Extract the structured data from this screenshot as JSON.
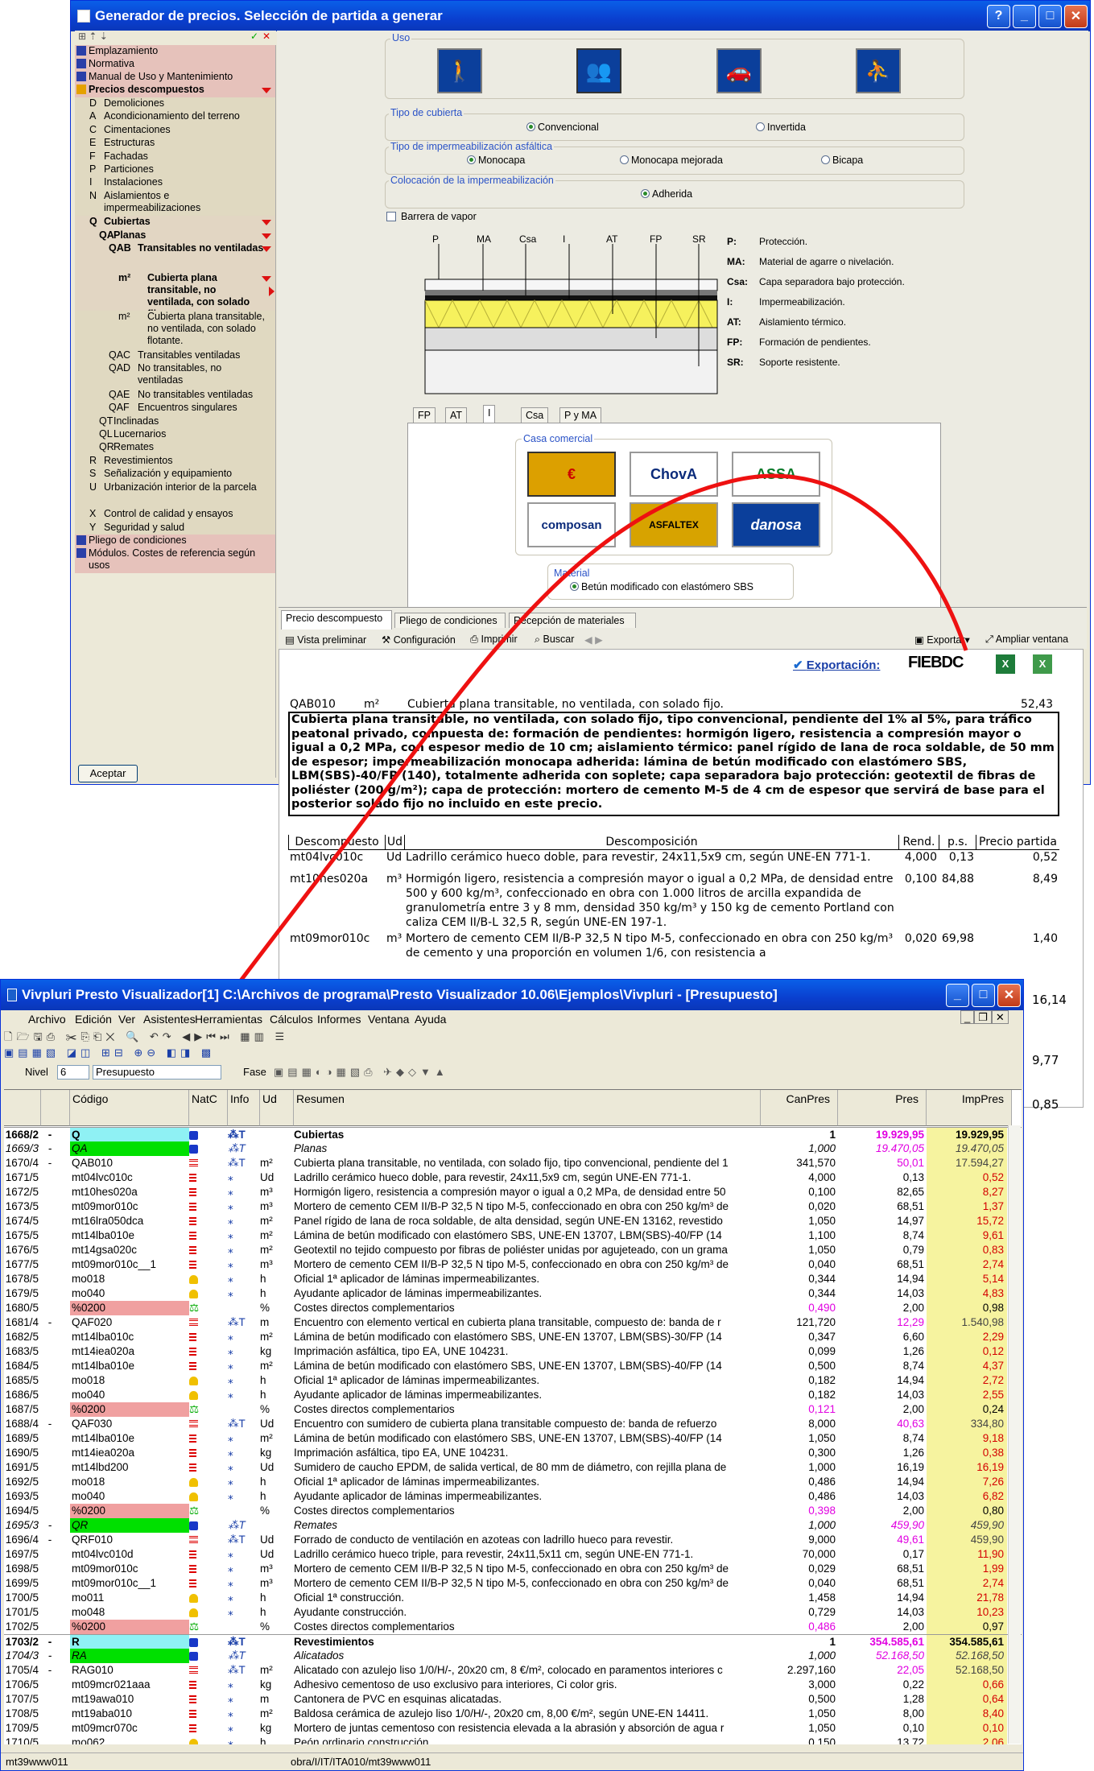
{
  "gen": {
    "title": "Generador de precios. Selección de partida a generar",
    "tree": [
      {
        "label": "Emplazamiento",
        "t": "hdr0"
      },
      {
        "label": "Normativa",
        "t": "hdr0"
      },
      {
        "label": "Manual de Uso y Mantenimiento",
        "t": "hdr0"
      },
      {
        "label": "Precios descompuestos",
        "t": "hdr"
      },
      {
        "code": "D",
        "label": "Demoliciones"
      },
      {
        "code": "A",
        "label": "Acondicionamiento del terreno"
      },
      {
        "code": "C",
        "label": "Cimentaciones"
      },
      {
        "code": "E",
        "label": "Estructuras"
      },
      {
        "code": "F",
        "label": "Fachadas"
      },
      {
        "code": "P",
        "label": "Particiones"
      },
      {
        "code": "I",
        "label": "Instalaciones"
      },
      {
        "code": "N",
        "label": "Aislamientos e impermeabilizaciones"
      },
      {
        "code": "Q",
        "label": "Cubiertas"
      },
      {
        "code": "QA",
        "label": "Planas"
      },
      {
        "code": "QAB",
        "label": "Transitables no ventiladas"
      },
      {
        "code": "m²",
        "label": "Cubierta plana transitable, no ventilada, con solado fijo."
      },
      {
        "code": "m²",
        "label": "Cubierta plana transitable, no ventilada, con solado flotante."
      },
      {
        "code": "QAC",
        "label": "Transitables ventiladas"
      },
      {
        "code": "QAD",
        "label": "No transitables, no ventiladas"
      },
      {
        "code": "QAE",
        "label": "No transitables ventiladas"
      },
      {
        "code": "QAF",
        "label": "Encuentros singulares"
      },
      {
        "code": "QT",
        "label": "Inclinadas"
      },
      {
        "code": "QL",
        "label": "Lucernarios"
      },
      {
        "code": "QR",
        "label": "Remates"
      },
      {
        "code": "R",
        "label": "Revestimientos"
      },
      {
        "code": "S",
        "label": "Señalización y equipamiento"
      },
      {
        "code": "U",
        "label": "Urbanización interior de la parcela"
      },
      {
        "code": "X",
        "label": "Control de calidad y ensayos"
      },
      {
        "code": "Y",
        "label": "Seguridad y salud"
      },
      {
        "label": "Pliego de condiciones",
        "t": "hdr0"
      },
      {
        "label": "Módulos. Costes de referencia según usos",
        "t": "hdr0"
      }
    ],
    "accept": "Aceptar",
    "uso": "Uso",
    "tipo_cubierta": "Tipo de cubierta",
    "convencional": "Convencional",
    "invertida": "Invertida",
    "tipo_imper": "Tipo de impermeabilización asfáltica",
    "monocapa": "Monocapa",
    "monocapa_mejorada": "Monocapa mejorada",
    "bicapa": "Bicapa",
    "colocacion": "Colocación de la impermeabilización",
    "adherida": "Adherida",
    "barrera": "Barrera de vapor",
    "diagram_labels": [
      "P",
      "MA",
      "Csa",
      "I",
      "AT",
      "FP",
      "SR"
    ],
    "legend": [
      {
        "k": "P:",
        "v": "Protección."
      },
      {
        "k": "MA:",
        "v": "Material de agarre o nivelación."
      },
      {
        "k": "Csa:",
        "v": "Capa separadora bajo protección."
      },
      {
        "k": "I:",
        "v": "Impermeabilización."
      },
      {
        "k": "AT:",
        "v": "Aislamiento térmico."
      },
      {
        "k": "FP:",
        "v": "Formación de pendientes."
      },
      {
        "k": "SR:",
        "v": "Soporte resistente."
      }
    ],
    "layer_tabs": [
      "FP",
      "AT",
      "I",
      "Csa",
      "P y MA"
    ],
    "casa": "Casa comercial",
    "brands": [
      "€",
      "ChovA",
      "ASSA",
      "composan",
      "ASFALTEX",
      "danosa"
    ],
    "material": "Material",
    "material_val": "Betún modificado con elastómero SBS",
    "doc_tabs": [
      "Precio descompuesto",
      "Pliego de condiciones",
      "Recepción de materiales"
    ],
    "doc_tools": [
      "Vista preliminar",
      "Configuración",
      "Imprimir",
      "Buscar"
    ],
    "exportar": "Exportar",
    "ampliar": "Ampliar ventana",
    "exportacion": "Exportación:",
    "fiebdc": "FIEBDC",
    "code": "QAB010",
    "unit": "m²",
    "short": "Cubierta plana transitable, no ventilada, con solado fijo.",
    "price": "52,43",
    "long": "Cubierta plana transitable, no ventilada, con solado fijo, tipo convencional, pendiente del 1% al 5%, para tráfico peatonal privado, compuesta de: formación de pendientes: hormigón ligero, resistencia a compresión mayor o igual a 0,2 MPa, con espesor medio de 10 cm; aislamiento térmico: panel rígido de lana de roca soldable, de 50 mm de espesor; impermeabilización monocapa adherida: lámina de betún modificado con elastómero SBS, LBM(SBS)-40/FP (140), totalmente adherida con soplete; capa separadora bajo protección: geotextil de fibras de poliéster (200 g/m²); capa de protección: mortero de cemento M-5 de 4 cm de espesor que servirá de base para el posterior solado fijo no incluido en este precio.",
    "dh": [
      "Descompuesto",
      "Ud",
      "Descomposición",
      "Rend.",
      "p.s.",
      "Precio partida"
    ],
    "drows": [
      [
        "mt04lvc010c",
        "Ud",
        "Ladrillo cerámico hueco doble, para revestir, 24x11,5x9 cm, según UNE-EN 771-1.",
        "4,000",
        "0,13",
        "0,52"
      ],
      [
        "mt10hes020a",
        "m³",
        "Hormigón ligero, resistencia a compresión mayor o igual a 0,2 MPa, de densidad entre 500 y 600 kg/m³, confeccionado en obra con 1.000 litros de arcilla expandida de granulometría entre 3 y 8 mm, densidad 350 kg/m³ y 150 kg de cemento Portland con caliza CEM II/B-L 32,5 R, según UNE-EN 197-1.",
        "0,100",
        "84,88",
        "8,49"
      ],
      [
        "mt09mor010c",
        "m³",
        "Mortero de cemento CEM II/B-P 32,5 N tipo M-5, confeccionado en obra con 250 kg/m³ de cemento y una proporción en volumen 1/6, con resistencia a",
        "0,020",
        "69,98",
        "1,40"
      ]
    ],
    "side_nums": [
      "16,14",
      "9,77",
      "0,85"
    ]
  },
  "viv": {
    "title": "Vivpluri Presto Visualizador[1] C:\\Archivos de programa\\Presto Visualizador 10.06\\Ejemplos\\Vivpluri - [Presupuesto]",
    "menu": [
      "Archivo",
      "Edición",
      "Ver",
      "Asistentes",
      "Herramientas",
      "Cálculos",
      "Informes",
      "Ventana",
      "Ayuda"
    ],
    "nivel": "Nivel",
    "nivel_val": "6",
    "tabla": "Presupuesto",
    "fase": "Fase",
    "cols": [
      "Código",
      "NatC",
      "Info",
      "Ud",
      "Resumen",
      "CanPres",
      "Pres",
      "ImpPres"
    ],
    "rows": [
      [
        "1668/2",
        "-",
        "Q",
        "c",
        "Cubiertas",
        "",
        "1",
        "19.929,95",
        "19.929,95",
        "b"
      ],
      [
        "1669/3",
        "-",
        "QA",
        "c",
        "Planas",
        "",
        "1,000",
        "19.470,05",
        "19.470,05",
        "i"
      ],
      [
        "1670/4",
        "-",
        "QAB010",
        "p",
        "Cubierta plana transitable, no ventilada, con solado fijo, tipo convencional, pendiente del 1",
        "m²",
        "341,570",
        "50,01",
        "17.594,27",
        "p"
      ],
      [
        "1671/5",
        "",
        "mt04lvc010c",
        "m",
        "Ladrillo cerámico hueco doble, para revestir, 24x11,5x9 cm, según UNE-EN 771-1.",
        "Ud",
        "4,000",
        "0,13",
        "0,52",
        ""
      ],
      [
        "1672/5",
        "",
        "mt10hes020a",
        "m",
        "Hormigón ligero, resistencia a compresión mayor o igual a 0,2 MPa, de densidad entre 50",
        "m³",
        "0,100",
        "82,65",
        "8,27",
        ""
      ],
      [
        "1673/5",
        "",
        "mt09mor010c",
        "m",
        "Mortero de cemento CEM II/B-P 32,5 N tipo M-5, confeccionado en obra con 250 kg/m³ de",
        "m³",
        "0,020",
        "68,51",
        "1,37",
        ""
      ],
      [
        "1674/5",
        "",
        "mt16lra050dca",
        "m",
        "Panel rígido de lana de roca soldable, de alta densidad, según UNE-EN 13162, revestido",
        "m²",
        "1,050",
        "14,97",
        "15,72",
        ""
      ],
      [
        "1675/5",
        "",
        "mt14lba010e",
        "m",
        "Lámina de betún modificado con elastómero SBS, UNE-EN 13707, LBM(SBS)-40/FP (14",
        "m²",
        "1,100",
        "8,74",
        "9,61",
        ""
      ],
      [
        "1676/5",
        "",
        "mt14gsa020c",
        "m",
        "Geotextil no tejido compuesto por fibras de poliéster unidas por agujeteado, con un grama",
        "m²",
        "1,050",
        "0,79",
        "0,83",
        ""
      ],
      [
        "1677/5",
        "",
        "mt09mor010c__1",
        "m",
        "Mortero de cemento CEM II/B-P 32,5 N tipo M-5, confeccionado en obra con 250 kg/m³ de",
        "m³",
        "0,040",
        "68,51",
        "2,74",
        ""
      ],
      [
        "1678/5",
        "",
        "mo018",
        "o",
        "Oficial 1ª aplicador de láminas impermeabilizantes.",
        "h",
        "0,344",
        "14,94",
        "5,14",
        ""
      ],
      [
        "1679/5",
        "",
        "mo040",
        "o",
        "Ayudante aplicador de láminas impermeabilizantes.",
        "h",
        "0,344",
        "14,03",
        "4,83",
        ""
      ],
      [
        "1680/5",
        "",
        "%0200",
        "x",
        "Costes directos complementarios",
        "%",
        "0,490",
        "2,00",
        "0,98",
        "r"
      ],
      [
        "1681/4",
        "-",
        "QAF020",
        "p",
        "Encuentro con elemento vertical en cubierta plana transitable, compuesto de: banda de r",
        "m",
        "121,720",
        "12,29",
        "1.540,98",
        "p"
      ],
      [
        "1682/5",
        "",
        "mt14lba010c",
        "m",
        "Lámina de betún modificado con elastómero SBS, UNE-EN 13707, LBM(SBS)-30/FP (14",
        "m²",
        "0,347",
        "6,60",
        "2,29",
        ""
      ],
      [
        "1683/5",
        "",
        "mt14iea020a",
        "m",
        "Imprimación asfáltica, tipo EA, UNE 104231.",
        "kg",
        "0,099",
        "1,26",
        "0,12",
        ""
      ],
      [
        "1684/5",
        "",
        "mt14lba010e",
        "m",
        "Lámina de betún modificado con elastómero SBS, UNE-EN 13707, LBM(SBS)-40/FP (14",
        "m²",
        "0,500",
        "8,74",
        "4,37",
        ""
      ],
      [
        "1685/5",
        "",
        "mo018",
        "o",
        "Oficial 1ª aplicador de láminas impermeabilizantes.",
        "h",
        "0,182",
        "14,94",
        "2,72",
        ""
      ],
      [
        "1686/5",
        "",
        "mo040",
        "o",
        "Ayudante aplicador de láminas impermeabilizantes.",
        "h",
        "0,182",
        "14,03",
        "2,55",
        ""
      ],
      [
        "1687/5",
        "",
        "%0200",
        "x",
        "Costes directos complementarios",
        "%",
        "0,121",
        "2,00",
        "0,24",
        "r"
      ],
      [
        "1688/4",
        "-",
        "QAF030",
        "p",
        "Encuentro con sumidero de cubierta plana transitable compuesto de: banda de refuerzo",
        "Ud",
        "8,000",
        "40,63",
        "334,80",
        "p"
      ],
      [
        "1689/5",
        "",
        "mt14lba010e",
        "m",
        "Lámina de betún modificado con elastómero SBS, UNE-EN 13707, LBM(SBS)-40/FP (14",
        "m²",
        "1,050",
        "8,74",
        "9,18",
        ""
      ],
      [
        "1690/5",
        "",
        "mt14iea020a",
        "m",
        "Imprimación asfáltica, tipo EA, UNE 104231.",
        "kg",
        "0,300",
        "1,26",
        "0,38",
        ""
      ],
      [
        "1691/5",
        "",
        "mt14lbd200",
        "m",
        "Sumidero de caucho EPDM, de salida vertical, de 80 mm de diámetro, con rejilla plana de",
        "Ud",
        "1,000",
        "16,19",
        "16,19",
        ""
      ],
      [
        "1692/5",
        "",
        "mo018",
        "o",
        "Oficial 1ª aplicador de láminas impermeabilizantes.",
        "h",
        "0,486",
        "14,94",
        "7,26",
        ""
      ],
      [
        "1693/5",
        "",
        "mo040",
        "o",
        "Ayudante aplicador de láminas impermeabilizantes.",
        "h",
        "0,486",
        "14,03",
        "6,82",
        ""
      ],
      [
        "1694/5",
        "",
        "%0200",
        "x",
        "Costes directos complementarios",
        "%",
        "0,398",
        "2,00",
        "0,80",
        "r"
      ],
      [
        "1695/3",
        "-",
        "QR",
        "c",
        "Remates",
        "",
        "1,000",
        "459,90",
        "459,90",
        "i"
      ],
      [
        "1696/4",
        "-",
        "QRF010",
        "p",
        "Forrado de conducto de ventilación en azoteas con ladrillo hueco para revestir.",
        "Ud",
        "9,000",
        "49,61",
        "459,90",
        "p"
      ],
      [
        "1697/5",
        "",
        "mt04lvc010d",
        "m",
        "Ladrillo cerámico hueco triple, para revestir, 24x11,5x11 cm, según UNE-EN 771-1.",
        "Ud",
        "70,000",
        "0,17",
        "11,90",
        ""
      ],
      [
        "1698/5",
        "",
        "mt09mor010c",
        "m",
        "Mortero de cemento CEM II/B-P 32,5 N tipo M-5, confeccionado en obra con 250 kg/m³ de",
        "m³",
        "0,029",
        "68,51",
        "1,99",
        ""
      ],
      [
        "1699/5",
        "",
        "mt09mor010c__1",
        "m",
        "Mortero de cemento CEM II/B-P 32,5 N tipo M-5, confeccionado en obra con 250 kg/m³ de",
        "m³",
        "0,040",
        "68,51",
        "2,74",
        ""
      ],
      [
        "1700/5",
        "",
        "mo011",
        "o",
        "Oficial 1ª construcción.",
        "h",
        "1,458",
        "14,94",
        "21,78",
        ""
      ],
      [
        "1701/5",
        "",
        "mo048",
        "o",
        "Ayudante construcción.",
        "h",
        "0,729",
        "14,03",
        "10,23",
        ""
      ],
      [
        "1702/5",
        "",
        "%0200",
        "x",
        "Costes directos complementarios",
        "%",
        "0,486",
        "2,00",
        "0,97",
        "r"
      ],
      [
        "1703/2",
        "-",
        "R",
        "c",
        "Revestimientos",
        "",
        "1",
        "354.585,61",
        "354.585,61",
        "b"
      ],
      [
        "1704/3",
        "-",
        "RA",
        "c",
        "Alicatados",
        "",
        "1,000",
        "52.168,50",
        "52.168,50",
        "i"
      ],
      [
        "1705/4",
        "-",
        "RAG010",
        "p",
        "Alicatado con azulejo liso 1/0/H/-, 20x20 cm, 8 €/m², colocado en paramentos interiores c",
        "m²",
        "2.297,160",
        "22,05",
        "52.168,50",
        "p"
      ],
      [
        "1706/5",
        "",
        "mt09mcr021aaa",
        "m",
        "Adhesivo cementoso de uso exclusivo para interiores, Ci color gris.",
        "kg",
        "3,000",
        "0,22",
        "0,66",
        ""
      ],
      [
        "1707/5",
        "",
        "mt19awa010",
        "m",
        "Cantonera de PVC en esquinas alicatadas.",
        "m",
        "0,500",
        "1,28",
        "0,64",
        ""
      ],
      [
        "1708/5",
        "",
        "mt19aba010",
        "m",
        "Baldosa cerámica de azulejo liso 1/0/H/-, 20x20 cm, 8,00 €/m², según UNE-EN 14411.",
        "m²",
        "1,050",
        "8,00",
        "8,40",
        ""
      ],
      [
        "1709/5",
        "",
        "mt09mcr070c",
        "m",
        "Mortero de juntas cementoso con resistencia elevada a la abrasión y absorción de agua r",
        "kg",
        "1,050",
        "0,10",
        "0,10",
        ""
      ],
      [
        "1710/5",
        "",
        "mo062",
        "o",
        "Peón ordinario construcción.",
        "h",
        "0,150",
        "13,72",
        "2,06",
        ""
      ]
    ],
    "status_left": "mt39www011",
    "status_mid": "obra/I/IT/ITA010/mt39www011"
  }
}
